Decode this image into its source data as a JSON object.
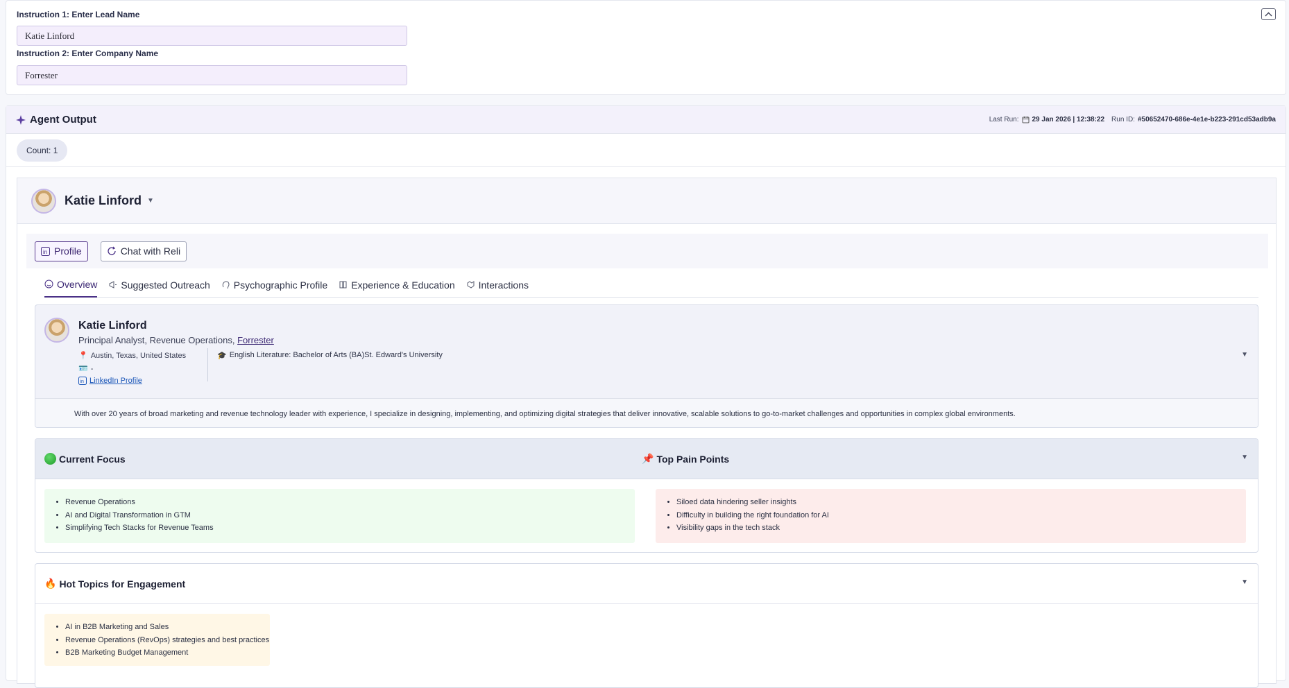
{
  "instructions": {
    "lead_label": "Instruction 1: Enter Lead Name",
    "lead_value": "Katie Linford",
    "company_label": "Instruction 2: Enter Company Name",
    "company_value": "Forrester"
  },
  "output": {
    "title": "Agent Output",
    "last_run_label": "Last Run:",
    "last_run_value": "29 Jan 2026 | 12:38:22",
    "run_id_label": "Run ID:",
    "run_id_value": "#50652470-686e-4e1e-b223-291cd53adb9a",
    "count": "Count: 1"
  },
  "lead": {
    "name": "Katie Linford",
    "tabs": [
      {
        "label": "Profile"
      },
      {
        "label": "Chat with Reli"
      }
    ],
    "subtabs": [
      {
        "label": "Overview"
      },
      {
        "label": "Suggested Outreach"
      },
      {
        "label": "Psychographic Profile"
      },
      {
        "label": "Experience & Education"
      },
      {
        "label": "Interactions"
      }
    ],
    "overview": {
      "name": "Katie Linford",
      "title": "Principal Analyst, Revenue Operations,",
      "company": "Forrester",
      "location": "Austin, Texas, United States",
      "email": "-",
      "linkedin": "LinkedIn Profile",
      "education": "English Literature: Bachelor of Arts (BA)St. Edward's University",
      "summary": "With over 20 years of broad marketing and revenue technology leader with experience, I specialize in designing, implementing, and optimizing digital strategies that deliver innovative, scalable solutions to go-to-market challenges and opportunities in complex global environments."
    },
    "current_focus": {
      "title": "Current Focus",
      "items": [
        "Revenue Operations",
        "AI and Digital Transformation in GTM",
        "Simplifying Tech Stacks for Revenue Teams"
      ]
    },
    "pain_points": {
      "title": "Top Pain Points",
      "items": [
        "Siloed data hindering seller insights",
        "Difficulty in building the right foundation for AI",
        "Visibility gaps in the tech stack"
      ]
    },
    "hot_topics": {
      "title": "Hot Topics for Engagement",
      "items": [
        "AI in B2B Marketing and Sales",
        "Revenue Operations (RevOps) strategies and best practices",
        "B2B Marketing Budget Management"
      ]
    }
  },
  "colors": {
    "accent": "#4a3187",
    "focus_bg": "#eefcef",
    "pain_bg": "#fdeceb",
    "hot_bg": "#fff7e6"
  }
}
